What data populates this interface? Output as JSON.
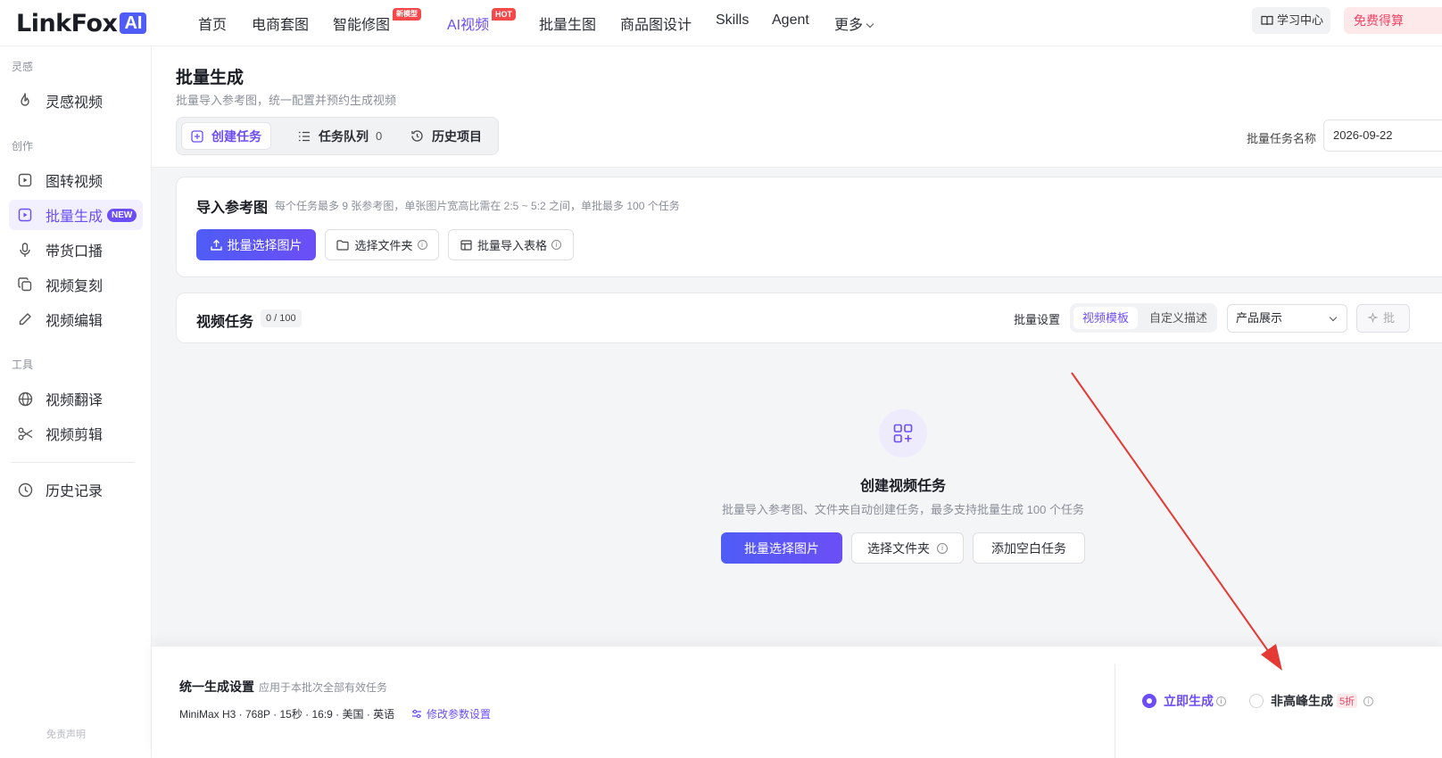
{
  "brand": {
    "logo_text": "LinkFox",
    "logo_badge": "AI"
  },
  "topnav": {
    "items": [
      {
        "label": "首页"
      },
      {
        "label": "电商套图"
      },
      {
        "label": "智能修图",
        "tag": "新模型"
      },
      {
        "label": "AI视频",
        "tag": "HOT",
        "active": true
      },
      {
        "label": "批量生图"
      },
      {
        "label": "商品图设计"
      },
      {
        "label": "Skills"
      },
      {
        "label": "Agent"
      },
      {
        "label": "更多"
      }
    ],
    "learn_center": "学习中心",
    "free_btn": "免费得算"
  },
  "sidebar": {
    "groups": [
      "灵感",
      "创作",
      "工具"
    ],
    "items": [
      {
        "label": "灵感视频",
        "icon": "flame-icon"
      },
      {
        "label": "图转视频",
        "icon": "play-square-icon"
      },
      {
        "label": "批量生成",
        "icon": "play-square-icon",
        "badge": "NEW",
        "active": true
      },
      {
        "label": "带货口播",
        "icon": "microphone-icon"
      },
      {
        "label": "视频复刻",
        "icon": "copy-icon"
      },
      {
        "label": "视频编辑",
        "icon": "pencil-icon"
      },
      {
        "label": "视频翻译",
        "icon": "globe-icon"
      },
      {
        "label": "视频剪辑",
        "icon": "scissors-icon"
      },
      {
        "label": "历史记录",
        "icon": "clock-icon"
      }
    ],
    "disclaimer": "免责声明"
  },
  "header": {
    "title": "批量生成",
    "subtitle": "批量导入参考图，统一配置并预约生成视频",
    "tabs": [
      {
        "label": "创建任务",
        "active": true
      },
      {
        "label": "任务队列",
        "count": "0"
      },
      {
        "label": "历史项目"
      }
    ],
    "batch_name_label": "批量任务名称",
    "batch_name_value": "2026-09-22"
  },
  "import": {
    "title": "导入参考图",
    "hint": "每个任务最多 9 张参考图，单张图片宽高比需在 2:5 ~ 5:2 之间，单批最多 100 个任务",
    "btn_batch_select": "批量选择图片",
    "btn_select_folder": "选择文件夹",
    "btn_import_table": "批量导入表格"
  },
  "tasks": {
    "title": "视频任务",
    "count": "0 / 100",
    "batch_settings_label": "批量设置",
    "segment": [
      "视频模板",
      "自定义描述"
    ],
    "select_value": "产品展示",
    "ai_btn": "批"
  },
  "empty": {
    "title": "创建视频任务",
    "subtitle": "批量导入参考图、文件夹自动创建任务，最多支持批量生成 100 个任务",
    "btn_batch_select": "批量选择图片",
    "btn_select_folder": "选择文件夹",
    "btn_add_blank": "添加空白任务"
  },
  "bottom": {
    "title": "统一生成设置",
    "hint": "应用于本批次全部有效任务",
    "params": "MiniMax H3 · 768P · 15秒 · 16:9 · 美国 · 英语",
    "modify": "修改参数设置",
    "radio_now": "立即生成",
    "radio_offpeak": "非高峰生成",
    "discount": "5折"
  },
  "colors": {
    "accent": "#6b4ef6",
    "primary_blue": "#4f5cf6",
    "hot_red": "#f5484b",
    "annotation_arrow": "#e53935"
  }
}
